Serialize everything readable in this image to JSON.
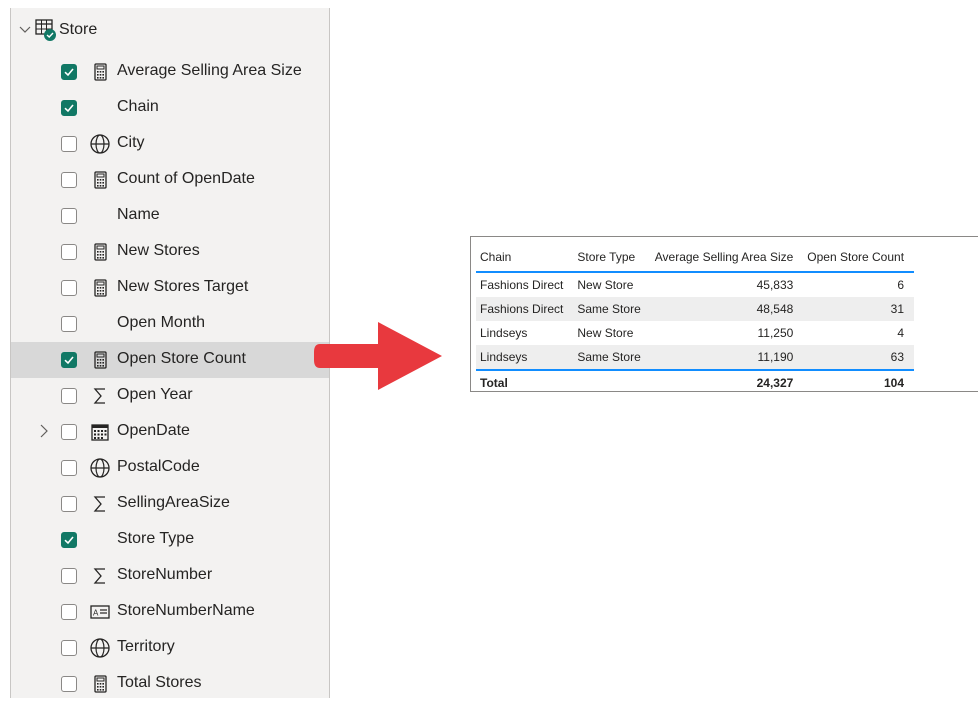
{
  "fields_pane": {
    "table_name": "Store",
    "fields": [
      {
        "label": "Average Selling Area Size",
        "icon": "calculator-icon",
        "checked": true
      },
      {
        "label": "Chain",
        "icon": "none",
        "checked": true
      },
      {
        "label": "City",
        "icon": "globe-icon",
        "checked": false
      },
      {
        "label": "Count of OpenDate",
        "icon": "calculator-icon",
        "checked": false
      },
      {
        "label": "Name",
        "icon": "none",
        "checked": false
      },
      {
        "label": "New Stores",
        "icon": "calculator-icon",
        "checked": false
      },
      {
        "label": "New Stores Target",
        "icon": "calculator-icon",
        "checked": false
      },
      {
        "label": "Open Month",
        "icon": "none",
        "checked": false
      },
      {
        "label": "Open Store Count",
        "icon": "calculator-icon",
        "checked": true,
        "selected": true
      },
      {
        "label": "Open Year",
        "icon": "sigma-icon",
        "checked": false
      },
      {
        "label": "OpenDate",
        "icon": "calendar-icon",
        "checked": false,
        "expandable": true
      },
      {
        "label": "PostalCode",
        "icon": "globe-icon",
        "checked": false
      },
      {
        "label": "SellingAreaSize",
        "icon": "sigma-icon",
        "checked": false
      },
      {
        "label": "Store Type",
        "icon": "none",
        "checked": true
      },
      {
        "label": "StoreNumber",
        "icon": "sigma-icon",
        "checked": false
      },
      {
        "label": "StoreNumberName",
        "icon": "id-card-icon",
        "checked": false
      },
      {
        "label": "Territory",
        "icon": "globe-icon",
        "checked": false
      },
      {
        "label": "Total Stores",
        "icon": "calculator-icon",
        "checked": false
      }
    ]
  },
  "colors": {
    "accent": "#117865",
    "table_rule": "#118dff",
    "arrow": "#e8393e"
  },
  "table_visual": {
    "headers": [
      "Chain",
      "Store Type",
      "Average Selling Area Size",
      "Open Store Count"
    ],
    "rows": [
      [
        "Fashions Direct",
        "New Store",
        "45,833",
        "6"
      ],
      [
        "Fashions Direct",
        "Same Store",
        "48,548",
        "31"
      ],
      [
        "Lindseys",
        "New Store",
        "11,250",
        "4"
      ],
      [
        "Lindseys",
        "Same Store",
        "11,190",
        "63"
      ]
    ],
    "total": [
      "Total",
      "",
      "24,327",
      "104"
    ]
  }
}
